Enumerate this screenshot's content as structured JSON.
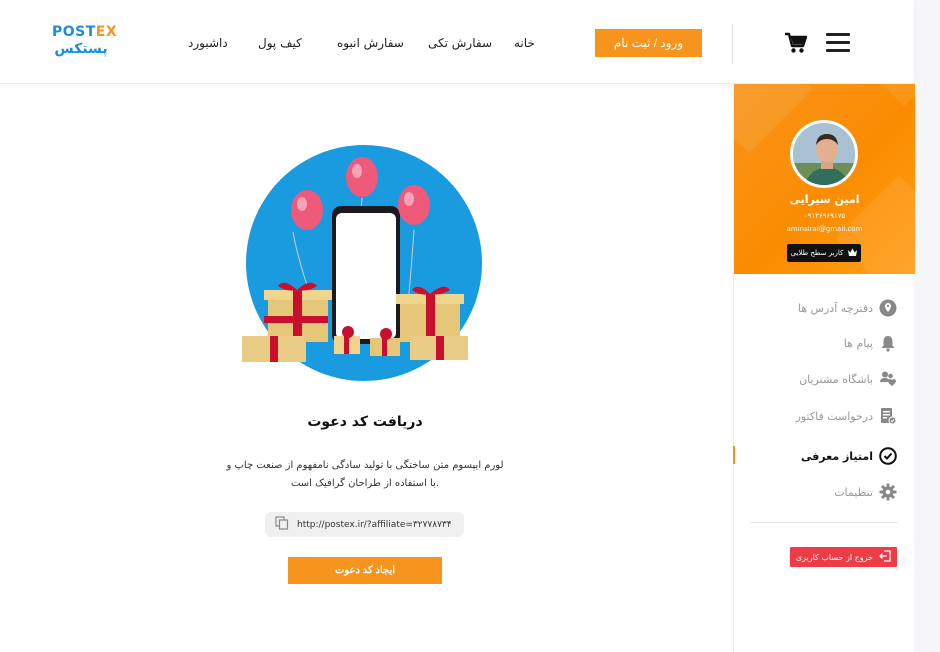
{
  "header": {
    "logo_top_a": "POST",
    "logo_top_b": "EX",
    "logo_bottom": "پستکس",
    "nav": {
      "home": "خانه",
      "single_order": "سفارش تکی",
      "bulk_order": "سفارش انبوه",
      "wallet": "کیف پول",
      "dashboard": "داشبورد"
    },
    "login_label": "ورود / ثبت نام"
  },
  "profile": {
    "name": "امین سیرایی",
    "phone": "۰۹۱۳۶۹۶۹۱۷۵",
    "email": "aminsirai@gmail.com",
    "level": "کاربر سطح طلایی"
  },
  "sidebar": {
    "items": [
      {
        "label": "دفترچه آدرس ها",
        "icon": "location-pin-icon"
      },
      {
        "label": "پیام ها",
        "icon": "bell-icon"
      },
      {
        "label": "باشگاه مشتریان",
        "icon": "users-heart-icon"
      },
      {
        "label": "درخواست فاکتور",
        "icon": "invoice-icon"
      },
      {
        "label": "امتیاز معرفی",
        "icon": "check-circle-icon"
      },
      {
        "label": "تنظیمات",
        "icon": "gear-icon"
      }
    ],
    "active_index": 4,
    "logout_label": "خروج از حساب کاربری"
  },
  "main": {
    "title": "دریافت کد دعوت",
    "description_line1": "لورم ایپسوم متن ساختگی با تولید سادگی نامفهوم از صنعت چاپ و",
    "description_line2": "با استفاده از طراحان گرافیک است.",
    "invite_link": "http://postex.ir/?affiliate=۳۲۷۷۸۷۳۴",
    "create_button": "ایجاد کد دعوت"
  },
  "colors": {
    "accent": "#f7941d",
    "brand_blue": "#1e8dd6",
    "logout": "#ef3b46",
    "illustration_bg": "#1a9be0"
  }
}
